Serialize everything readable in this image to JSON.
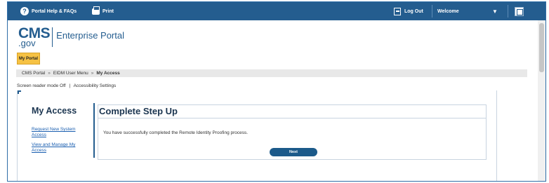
{
  "topbar": {
    "help_label": "Portal Help & FAQs",
    "print_label": "Print",
    "logout_label": "Log Out",
    "welcome_label": "Welcome",
    "caret": "▼"
  },
  "logo": {
    "cms": "CMS",
    "gov": ".gov",
    "portal_name": "Enterprise Portal"
  },
  "my_portal_label": "My Portal",
  "breadcrumb": {
    "items": [
      "CMS Portal",
      "EIDM User Menu",
      "My Access"
    ],
    "separator": "»"
  },
  "reader": {
    "mode_text": "Screen reader mode Off",
    "separator": "|",
    "settings_text": "Accessibility Settings"
  },
  "sidebar": {
    "title": "My Access",
    "links": [
      "Request New System Access",
      "View and Manage My Access"
    ]
  },
  "main": {
    "title": "Complete Step Up",
    "message": "You have successfully completed the Remote Identity Proofing process.",
    "next_label": "Next"
  },
  "colors": {
    "topbar": "#245d8f",
    "accent_yellow": "#f6c244",
    "button": "#1c5a8a"
  }
}
